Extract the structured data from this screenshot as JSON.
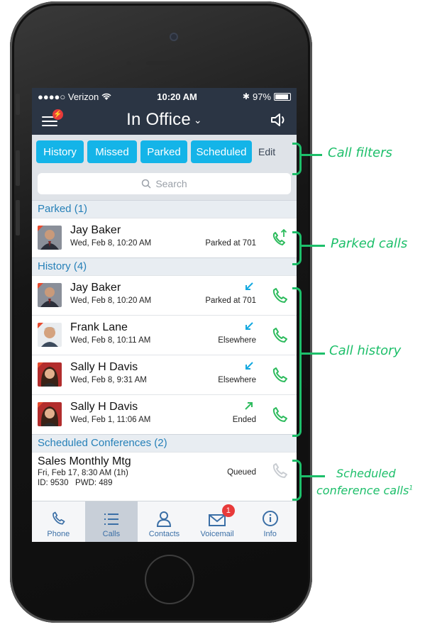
{
  "status_bar": {
    "carrier": "●●●●○ Verizon",
    "time": "10:20 AM",
    "battery": "97%"
  },
  "nav": {
    "title": "In Office",
    "menu_badge": "⚡"
  },
  "filters": [
    "History",
    "Missed",
    "Parked",
    "Scheduled"
  ],
  "filter_edit": "Edit",
  "search": {
    "placeholder": "Search"
  },
  "parked": {
    "header": "Parked (1)",
    "rows": [
      {
        "name": "Jay Baker",
        "date": "Wed, Feb 8, 10:20 AM",
        "status": "Parked at 701"
      }
    ]
  },
  "history": {
    "header": "History (4)",
    "rows": [
      {
        "name": "Jay Baker",
        "date": "Wed, Feb 8, 10:20 AM",
        "status": "Parked at 701",
        "direction": "incoming"
      },
      {
        "name": "Frank Lane",
        "date": "Wed, Feb 8, 10:11 AM",
        "status": "Elsewhere",
        "direction": "incoming"
      },
      {
        "name": "Sally H Davis",
        "date": "Wed, Feb 8, 9:31 AM",
        "status": "Elsewhere",
        "direction": "incoming"
      },
      {
        "name": "Sally H Davis",
        "date": "Wed, Feb 1, 11:06 AM",
        "status": "Ended",
        "direction": "outgoing"
      }
    ]
  },
  "scheduled": {
    "header": "Scheduled Conferences (2)",
    "rows": [
      {
        "title": "Sales Monthly Mtg",
        "date": "Fri, Feb 17, 8:30 AM (1h)",
        "id": "ID: 9530   PWD: 489",
        "status": "Queued"
      }
    ]
  },
  "tabs": [
    {
      "label": "Phone",
      "icon": "phone-icon"
    },
    {
      "label": "Calls",
      "icon": "list-icon"
    },
    {
      "label": "Contacts",
      "icon": "person-icon"
    },
    {
      "label": "Voicemail",
      "icon": "envelope-icon",
      "badge": "1"
    },
    {
      "label": "Info",
      "icon": "info-icon"
    }
  ],
  "annotations": {
    "filters": "Call filters",
    "parked": "Parked calls",
    "history": "Call history",
    "scheduled_line1": "Scheduled",
    "scheduled_line2": "conference calls",
    "scheduled_sup": "1"
  },
  "colors": {
    "nav_bg": "#2b3544",
    "filter_accent": "#14b4e8",
    "section_text": "#2680b8",
    "call_green": "#2dbb5d",
    "annotation_green": "#1dbf6a",
    "badge_red": "#e83a3a"
  }
}
